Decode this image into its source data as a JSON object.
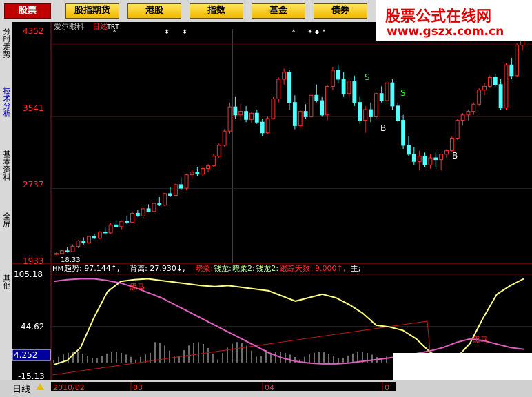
{
  "topbar": {
    "tabs": [
      "股票",
      "股指期货",
      "港股",
      "指数",
      "基金",
      "债券"
    ]
  },
  "watermark": {
    "line1": "股票公式在线网",
    "line2": "www.gszx.com.cn"
  },
  "sidebar": {
    "items": [
      "分时走势",
      "技术分析",
      "基本资料",
      "全屏",
      "其他"
    ]
  },
  "main_chart": {
    "header_name": "爱尔眼科",
    "header_period": "日线",
    "header_formula": "TRT",
    "y_labels": [
      "4352",
      "3541",
      "2737",
      "1933"
    ],
    "low_label": "18.33"
  },
  "indicator_panel": {
    "name": "HM",
    "legend": [
      {
        "text": "趋势: 97.144↑,",
        "color": "#ffffff"
      },
      {
        "text": "背离: 27.930↓,",
        "color": "#ffffff"
      },
      {
        "text": "晓柔:",
        "color": "#ff3030"
      },
      {
        "text": "钱龙:",
        "color": "#c0ffa0"
      },
      {
        "text": "晓柔2:",
        "color": "#c0ffa0"
      },
      {
        "text": "钱龙2:",
        "color": "#c0ffa0"
      },
      {
        "text": "跟踪天数: 9.000↑,",
        "color": "#ff3030"
      },
      {
        "text": "主;",
        "color": "#ffffff"
      }
    ],
    "y_labels": [
      "105.18",
      "44.62",
      "4.252",
      "-15.13"
    ],
    "annotations": [
      "黑马",
      "黑马"
    ]
  },
  "bottom": {
    "period_label": "日线"
  },
  "x_axis": {
    "labels": [
      "2010/02",
      "03",
      "04",
      "0"
    ]
  },
  "chart_data": [
    {
      "type": "candlestick",
      "title": "爱尔眼科",
      "ylim": [
        1900,
        4600
      ],
      "signals": {
        "S": [
          "S",
          "S"
        ],
        "B": [
          "B",
          "B"
        ]
      },
      "ohlc": [
        [
          2000,
          2030,
          1990,
          2010
        ],
        [
          2010,
          2050,
          2000,
          2040
        ],
        [
          2040,
          2080,
          2020,
          2030
        ],
        [
          2030,
          2100,
          2030,
          2090
        ],
        [
          2090,
          2160,
          2070,
          2150
        ],
        [
          2150,
          2190,
          2110,
          2130
        ],
        [
          2130,
          2210,
          2120,
          2200
        ],
        [
          2200,
          2230,
          2170,
          2180
        ],
        [
          2180,
          2260,
          2170,
          2250
        ],
        [
          2250,
          2310,
          2220,
          2240
        ],
        [
          2240,
          2350,
          2230,
          2330
        ],
        [
          2330,
          2380,
          2300,
          2310
        ],
        [
          2310,
          2380,
          2280,
          2370
        ],
        [
          2370,
          2430,
          2340,
          2360
        ],
        [
          2360,
          2470,
          2350,
          2460
        ],
        [
          2460,
          2500,
          2420,
          2430
        ],
        [
          2430,
          2520,
          2400,
          2510
        ],
        [
          2510,
          2560,
          2470,
          2480
        ],
        [
          2480,
          2580,
          2470,
          2570
        ],
        [
          2570,
          2640,
          2540,
          2550
        ],
        [
          2550,
          2690,
          2540,
          2680
        ],
        [
          2680,
          2750,
          2640,
          2660
        ],
        [
          2660,
          2790,
          2650,
          2780
        ],
        [
          2780,
          2860,
          2720,
          2740
        ],
        [
          2740,
          2900,
          2720,
          2890
        ],
        [
          2890,
          2950,
          2860,
          2920
        ],
        [
          2920,
          2980,
          2880,
          2900
        ],
        [
          2900,
          2980,
          2870,
          2960
        ],
        [
          2960,
          3010,
          2920,
          2990
        ],
        [
          2990,
          3120,
          2980,
          3100
        ],
        [
          3100,
          3240,
          3080,
          3220
        ],
        [
          3220,
          3400,
          3200,
          3380
        ],
        [
          3380,
          3700,
          3350,
          3650
        ],
        [
          3650,
          3760,
          3520,
          3560
        ],
        [
          3560,
          3680,
          3500,
          3600
        ],
        [
          3600,
          3660,
          3480,
          3510
        ],
        [
          3510,
          3600,
          3470,
          3580
        ],
        [
          3580,
          3620,
          3460,
          3480
        ],
        [
          3480,
          3520,
          3320,
          3360
        ],
        [
          3360,
          3540,
          3350,
          3520
        ],
        [
          3520,
          3760,
          3510,
          3740
        ],
        [
          3740,
          3980,
          3700,
          3960
        ],
        [
          3960,
          4080,
          3900,
          4040
        ],
        [
          4040,
          4060,
          3620,
          3700
        ],
        [
          3700,
          3780,
          3400,
          3440
        ],
        [
          3440,
          3620,
          3420,
          3600
        ],
        [
          3600,
          3680,
          3520,
          3540
        ],
        [
          3540,
          3800,
          3530,
          3780
        ],
        [
          3780,
          3900,
          3700,
          3720
        ],
        [
          3720,
          3760,
          3540,
          3560
        ],
        [
          3560,
          3900,
          3500,
          3880
        ],
        [
          3880,
          4100,
          3840,
          4060
        ],
        [
          4060,
          4120,
          3920,
          3960
        ],
        [
          3960,
          4040,
          3760,
          3800
        ],
        [
          3800,
          3960,
          3760,
          3940
        ],
        [
          3940,
          4000,
          3660,
          3700
        ],
        [
          3700,
          3760,
          3460,
          3500
        ],
        [
          3500,
          3660,
          3360,
          3620
        ],
        [
          3620,
          3700,
          3480,
          3540
        ],
        [
          3540,
          3820,
          3520,
          3800
        ],
        [
          3800,
          3880,
          3700,
          3720
        ],
        [
          3720,
          3940,
          3700,
          3920
        ],
        [
          3920,
          3960,
          3620,
          3660
        ],
        [
          3660,
          3700,
          3480,
          3500
        ],
        [
          3500,
          3560,
          3180,
          3220
        ],
        [
          3220,
          3320,
          3100,
          3120
        ],
        [
          3120,
          3200,
          3000,
          3040
        ],
        [
          3040,
          3160,
          2940,
          3100
        ],
        [
          3100,
          3140,
          2980,
          3000
        ],
        [
          3000,
          3120,
          2960,
          3080
        ],
        [
          3080,
          3140,
          2980,
          3060
        ],
        [
          3060,
          3120,
          2940,
          3120
        ],
        [
          3120,
          3180,
          3080,
          3160
        ],
        [
          3160,
          3320,
          3140,
          3300
        ],
        [
          3300,
          3520,
          3280,
          3500
        ],
        [
          3500,
          3580,
          3440,
          3560
        ],
        [
          3560,
          3620,
          3500,
          3600
        ],
        [
          3600,
          3700,
          3560,
          3680
        ],
        [
          3680,
          3860,
          3660,
          3840
        ],
        [
          3840,
          3920,
          3780,
          3880
        ],
        [
          3880,
          4000,
          3860,
          3980
        ],
        [
          3980,
          4020,
          3880,
          3900
        ],
        [
          3900,
          3960,
          3620,
          3640
        ],
        [
          3640,
          4140,
          3620,
          4120
        ],
        [
          4120,
          4200,
          3960,
          4000
        ],
        [
          4000,
          4360,
          3980,
          4340
        ],
        [
          4340,
          4460,
          4280,
          4440
        ]
      ]
    },
    {
      "type": "line",
      "title": "HM",
      "ylim": [
        -15.13,
        105.18
      ],
      "series": [
        {
          "name": "趋势",
          "color": "#ffff80",
          "values": [
            0,
            5,
            20,
            55,
            85,
            97,
            99,
            100,
            98,
            96,
            94,
            92,
            91,
            92,
            90,
            88,
            86,
            80,
            74,
            78,
            82,
            78,
            70,
            60,
            46,
            44,
            40,
            30,
            15,
            5,
            8,
            25,
            55,
            82,
            92,
            100
          ]
        },
        {
          "name": "背离",
          "color": "#e060c0",
          "values": [
            97,
            99,
            100,
            100,
            98,
            95,
            90,
            84,
            78,
            70,
            62,
            54,
            46,
            38,
            30,
            22,
            14,
            8,
            4,
            2,
            1,
            1,
            2,
            4,
            6,
            8,
            10,
            13,
            16,
            20,
            26,
            30,
            28,
            24,
            20,
            18
          ]
        }
      ]
    }
  ]
}
